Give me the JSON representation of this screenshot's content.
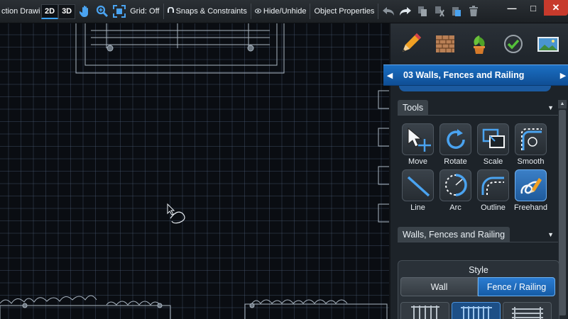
{
  "toolbar": {
    "title": "ction Drawi",
    "view_2d": "2D",
    "view_3d": "3D",
    "grid": "Grid: Off",
    "snaps": "Snaps & Constraints",
    "hide": "Hide/Unhide",
    "object_properties": "Object Properties"
  },
  "window": {
    "minimize": "—",
    "maximize": "□",
    "close": "✕"
  },
  "panel": {
    "category_icons": [
      "pencil-icon",
      "brick-icon",
      "plant-icon",
      "checkmark-icon",
      "landscape-photo-icon"
    ],
    "category_label": "03 Walls, Fences and Railing",
    "tools_header": "Tools",
    "tools": [
      {
        "label": "Move",
        "icon": "move-icon"
      },
      {
        "label": "Rotate",
        "icon": "rotate-icon"
      },
      {
        "label": "Scale",
        "icon": "scale-icon"
      },
      {
        "label": "Smooth",
        "icon": "smooth-icon"
      },
      {
        "label": "Line",
        "icon": "line-icon"
      },
      {
        "label": "Arc",
        "icon": "arc-icon"
      },
      {
        "label": "Outline",
        "icon": "outline-icon"
      },
      {
        "label": "Freehand",
        "icon": "freehand-icon",
        "active": true
      }
    ],
    "walls_header": "Walls, Fences and Railing",
    "style_title": "Style",
    "style_options": [
      "Wall",
      "Fence / Railing"
    ],
    "style_selected": "Fence / Railing"
  },
  "colors": {
    "accent": "#1b6fc2",
    "canvas": "#0a0d12",
    "close": "#c73a2c"
  }
}
